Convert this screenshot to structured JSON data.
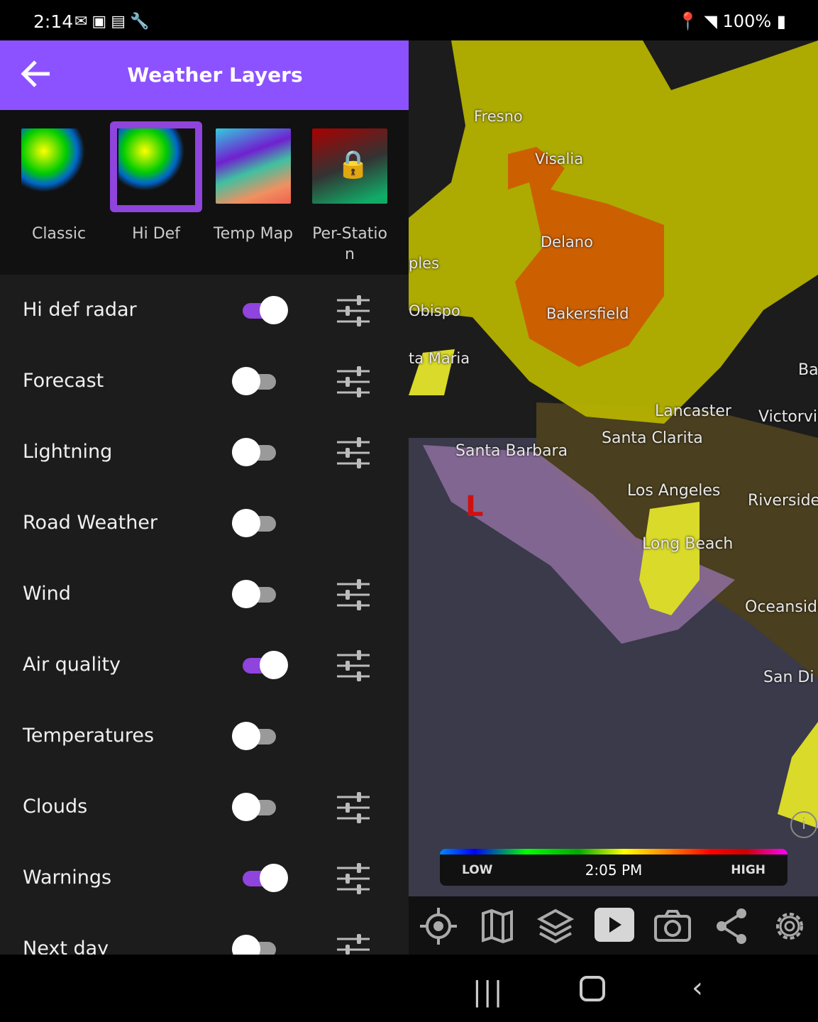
{
  "status_bar": {
    "time": "2:14",
    "battery": "100%",
    "left_icons": [
      "gmail-icon",
      "file-icon",
      "calendar-icon",
      "wrench-icon"
    ],
    "right_icons": [
      "location-icon",
      "wifi-icon",
      "signal-icon",
      "battery-icon"
    ]
  },
  "header": {
    "title": "Weather Layers",
    "back_icon": "arrow-left-icon",
    "color": "#8c52ff"
  },
  "styles": [
    {
      "label": "Classic",
      "selected": false
    },
    {
      "label": "Hi Def",
      "selected": true
    },
    {
      "label": "Temp Map",
      "selected": false
    },
    {
      "label": "Per-Station",
      "locked": true,
      "selected": false
    }
  ],
  "layers": [
    {
      "label": "Hi def radar",
      "on": true,
      "settings": true
    },
    {
      "label": "Forecast",
      "on": false,
      "settings": true
    },
    {
      "label": "Lightning",
      "on": false,
      "settings": true
    },
    {
      "label": "Road Weather",
      "on": false,
      "settings": false
    },
    {
      "label": "Wind",
      "on": false,
      "settings": true
    },
    {
      "label": "Air quality",
      "on": true,
      "settings": true
    },
    {
      "label": "Temperatures",
      "on": false,
      "settings": false
    },
    {
      "label": "Clouds",
      "on": false,
      "settings": true
    },
    {
      "label": "Warnings",
      "on": true,
      "settings": true
    },
    {
      "label": "Next day",
      "on": false,
      "settings": true
    }
  ],
  "map": {
    "cities": [
      "Fresno",
      "Visalia",
      "Delano",
      "Bakersfield",
      "ples",
      "Obispo",
      "ta Maria",
      "Lancaster",
      "Victorvill",
      "Bar",
      "Santa Clarita",
      "Santa Barbara",
      "Los Angeles",
      "Riverside",
      "Long Beach",
      "Oceanside",
      "San Di"
    ],
    "marker": "L"
  },
  "legend": {
    "low": "LOW",
    "time": "2:05 PM",
    "high": "HIGH"
  },
  "toolbar": [
    "locate-icon",
    "map-icon",
    "layers-icon",
    "play-icon",
    "camera-icon",
    "share-icon",
    "settings-icon"
  ]
}
